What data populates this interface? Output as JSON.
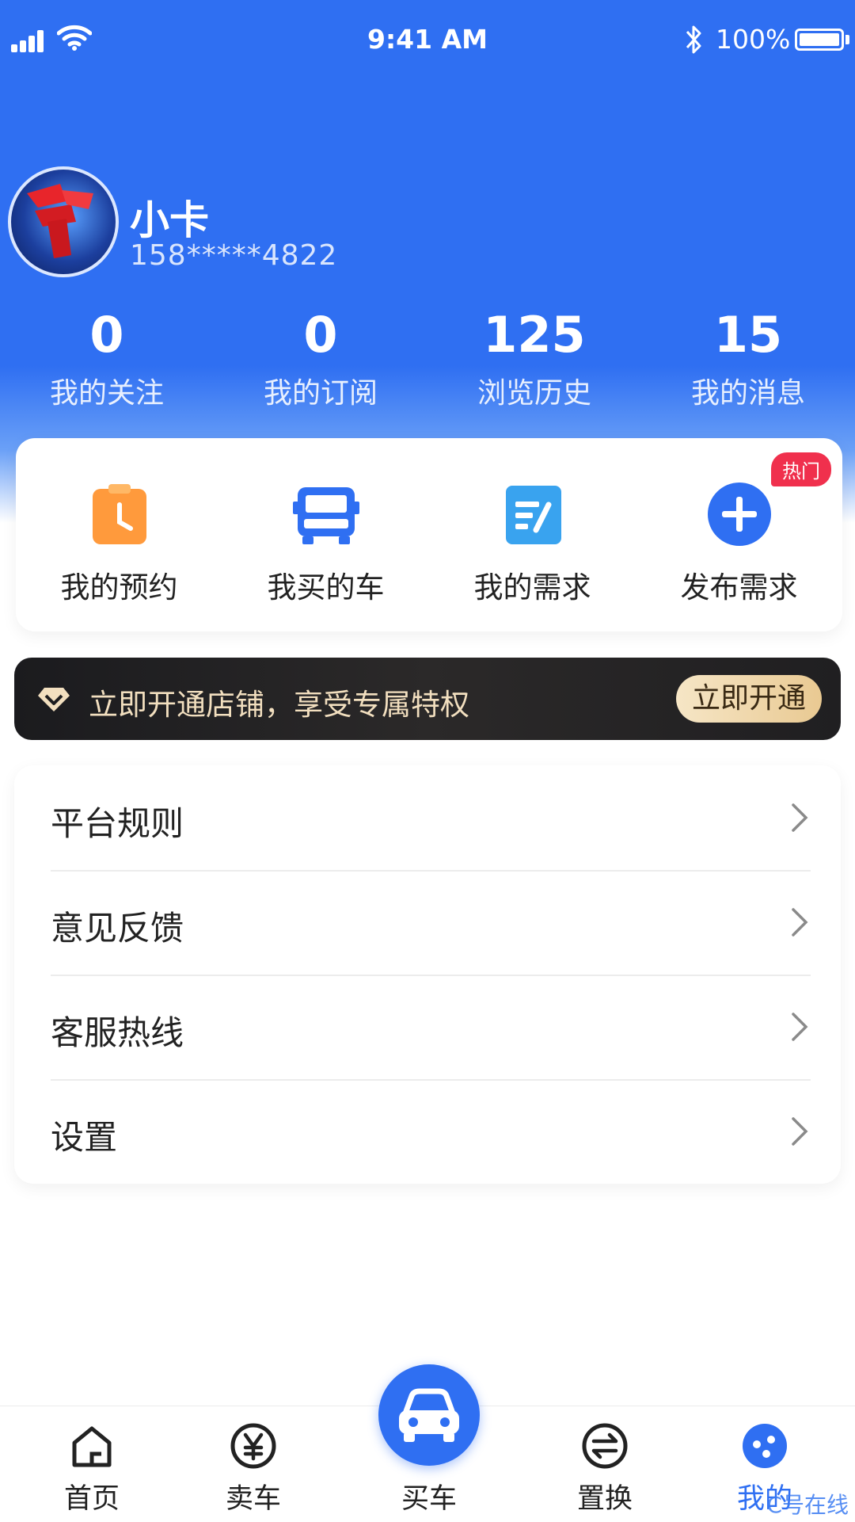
{
  "status_bar": {
    "time": "9:41 AM",
    "battery": "100%"
  },
  "profile": {
    "name": "小卡",
    "phone": "158*****4822"
  },
  "stats": [
    {
      "value": "0",
      "label": "我的关注"
    },
    {
      "value": "0",
      "label": "我的订阅"
    },
    {
      "value": "125",
      "label": "浏览历史"
    },
    {
      "value": "15",
      "label": "我的消息"
    }
  ],
  "quick_actions": [
    {
      "label": "我的预约",
      "icon": "calendar-clock-icon"
    },
    {
      "label": "我买的车",
      "icon": "truck-icon"
    },
    {
      "label": "我的需求",
      "icon": "document-edit-icon"
    },
    {
      "label": "发布需求",
      "icon": "plus-circle-icon",
      "badge": "热门"
    }
  ],
  "banner": {
    "text": "立即开通店铺，享受专属特权",
    "button": "立即开通"
  },
  "menu": [
    {
      "label": "平台规则"
    },
    {
      "label": "意见反馈"
    },
    {
      "label": "客服热线"
    },
    {
      "label": "设置"
    }
  ],
  "tabbar": {
    "items": [
      {
        "label": "首页",
        "icon": "home-icon"
      },
      {
        "label": "卖车",
        "icon": "yen-icon"
      },
      {
        "label": "买车",
        "icon": "car-icon"
      },
      {
        "label": "置换",
        "icon": "swap-icon"
      },
      {
        "label": "我的",
        "icon": "profile-icon"
      }
    ],
    "active": "我的"
  },
  "watermark": "C号在线",
  "colors": {
    "primary": "#2f6ff2",
    "hot": "#f0304d",
    "gold": "#e9c992"
  }
}
